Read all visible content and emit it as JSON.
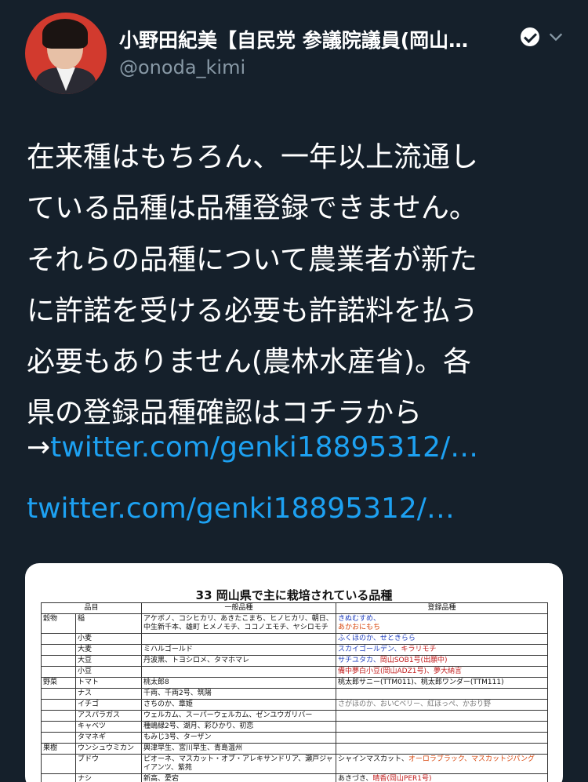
{
  "tweet": {
    "display_name": "小野田紀美【自民党 参議院議員(岡山…",
    "handle": "@onoda_kimi",
    "text_lines": [
      "在来種はもちろん、一年以上流通し",
      "ている品種は品種登録できません。",
      "それらの品種について農業者が新た",
      "に許諾を受ける必要も許諾料を払う",
      "必要もありません(農林水産省)。各",
      "県の登録品種確認はコチラから"
    ],
    "arrow": "→",
    "inline_link": "twitter.com/genki18895312/…",
    "quoted_link": "twitter.com/genki18895312/…",
    "icons": [
      "verified-badge-icon",
      "chevron-down-icon"
    ],
    "colors": {
      "background": "#15202b",
      "link": "#1da1f2",
      "secondary": "#8899a6"
    }
  },
  "image": {
    "title": "33 岡山県で主に栽培されている品種",
    "headers": [
      "品目",
      "一般品種",
      "登録品種"
    ],
    "rows": [
      {
        "cat": "穀物",
        "item": "稲",
        "general": "アケボノ、コシヒカリ、あきたこまち、ヒノヒカリ、朝日、中生新千本、雄町 ヒメノモチ、ココノエモチ、ヤシロモチ",
        "registered": "きぬむすめ、",
        "registered2": "あかおにもち"
      },
      {
        "cat": "",
        "item": "小麦",
        "general": "",
        "registered": "ふくほのか、せときらら",
        "registered2": ""
      },
      {
        "cat": "",
        "item": "大麦",
        "general": "ミハルゴールド",
        "registered": "スカイゴールデン、",
        "registered2": "キラリモチ"
      },
      {
        "cat": "",
        "item": "大豆",
        "general": "丹波黒、トヨシロメ、タマホマレ",
        "registered": "サチユタカ、",
        "registered2": "岡山SOB1号(出願中)"
      },
      {
        "cat": "",
        "item": "小豆",
        "general": "",
        "registered": "備中夢白小豆(岡山ADZ1号)、",
        "registered2": "夢大納言"
      },
      {
        "cat": "野菜",
        "item": "トマト",
        "general": "桃太郎8",
        "registered": "桃太郎サニー(TTM011)、桃太郎ワンダー(TTM111)",
        "registered2": ""
      },
      {
        "cat": "",
        "item": "ナス",
        "general": "千両、千両2号、筑陽",
        "registered": "",
        "registered2": ""
      },
      {
        "cat": "",
        "item": "イチゴ",
        "general": "さちのか、章姫",
        "registered": "さがほのか、おいCベリー、紅ほっぺ、かおり野",
        "registered2": ""
      },
      {
        "cat": "",
        "item": "アスパラガス",
        "general": "ウェルカム、スーパーウェルカム、ゼンユウガリバー",
        "registered": "",
        "registered2": ""
      },
      {
        "cat": "",
        "item": "キャベツ",
        "general": "種嶋緑2号、湖月、彩ひかり、初恋",
        "registered": "",
        "registered2": ""
      },
      {
        "cat": "",
        "item": "タマネギ",
        "general": "もみじ3号、ターザン",
        "registered": "",
        "registered2": ""
      },
      {
        "cat": "果樹",
        "item": "ウンシュウミカン",
        "general": "興津早生、宮川早生、青島温州",
        "registered": "",
        "registered2": ""
      },
      {
        "cat": "",
        "item": "ブドウ",
        "general": "ピオーネ、マスカット・オブ・アレキサンドリア、瀬戸ジャイアンツ、紫苑",
        "registered": "シャインマスカット、",
        "registered2": "オーロラブラック、マスカットジパング"
      },
      {
        "cat": "",
        "item": "ナシ",
        "general": "新高、愛宕",
        "registered": "あきづき、",
        "registered2": "晴香(岡山PER1号)"
      }
    ]
  }
}
